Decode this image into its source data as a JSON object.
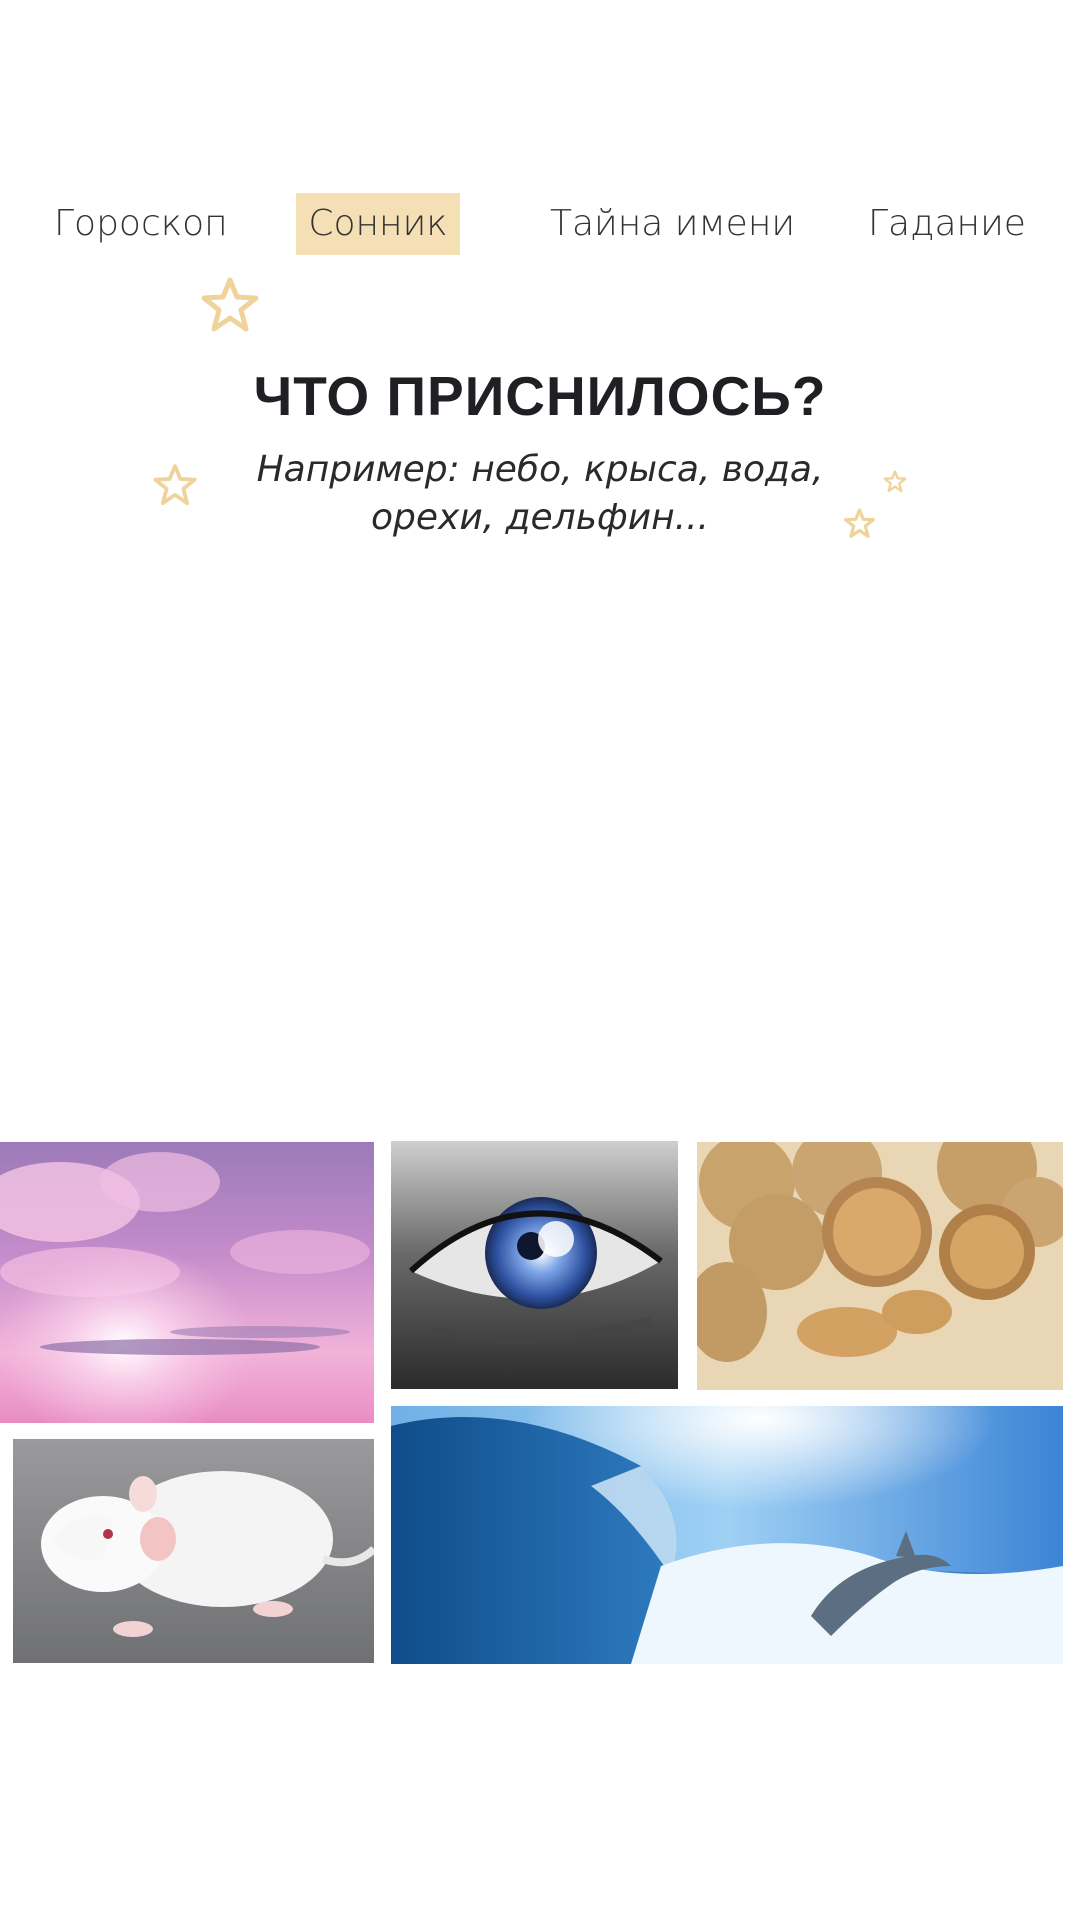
{
  "nav": {
    "items": [
      {
        "label": "Гороскоп",
        "active": false
      },
      {
        "label": "Сонник",
        "active": true
      },
      {
        "label": "Тайна имени",
        "active": false
      },
      {
        "label": "Гадание",
        "active": false
      }
    ],
    "active_color": "#f5dfb5"
  },
  "hero": {
    "title": "ЧТО ПРИСНИЛОСЬ?",
    "subtitle_line1": "Например: небо, крыса, вода,",
    "subtitle_line2": "орехи, дельфин..."
  },
  "decor": {
    "star_color": "#f0d39a",
    "icon": "star-outline-icon"
  },
  "gallery": {
    "tiles": [
      {
        "name": "sky",
        "icon": "pink-sky-clouds-image"
      },
      {
        "name": "eye",
        "icon": "eye-closeup-image"
      },
      {
        "name": "nuts",
        "icon": "walnuts-image"
      },
      {
        "name": "rat",
        "icon": "white-rat-image"
      },
      {
        "name": "wave",
        "icon": "ocean-wave-dolphin-image"
      }
    ]
  }
}
